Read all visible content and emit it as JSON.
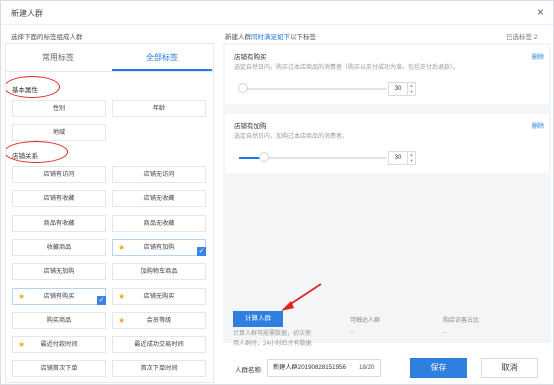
{
  "dialog": {
    "title": "新建人群",
    "close_icon": "close-icon"
  },
  "left_hint": "选择下面的标签组成人群",
  "right_hint": {
    "prefix": "新建人群",
    "accent": "同时满足如下",
    "suffix": "以下标签"
  },
  "selected_count": "已选标签 2",
  "tabs": [
    {
      "label": "常用标签"
    },
    {
      "label": "全部标签",
      "active": true
    }
  ],
  "sections": {
    "basic": "基本属性",
    "shop": "店铺关系"
  },
  "basic_tags": [
    {
      "label": "性别"
    },
    {
      "label": "年龄"
    },
    {
      "label": "地域"
    }
  ],
  "shop_tags": [
    {
      "label": "店铺有访问",
      "star": false,
      "selected": false
    },
    {
      "label": "店铺无访问",
      "star": false,
      "selected": false
    },
    {
      "label": "店铺有收藏",
      "star": false,
      "selected": false
    },
    {
      "label": "店铺无收藏",
      "star": false,
      "selected": false
    },
    {
      "label": "商品有收藏",
      "star": false,
      "selected": false
    },
    {
      "label": "商品无收藏",
      "star": false,
      "selected": false
    },
    {
      "label": "收藏商品",
      "star": false,
      "selected": false
    },
    {
      "label": "店铺有加购",
      "star": true,
      "selected": true
    },
    {
      "label": "店铺无加购",
      "star": false,
      "selected": false
    },
    {
      "label": "加购物车商品",
      "star": false,
      "selected": false
    },
    {
      "label": "店铺有购买",
      "star": true,
      "selected": true
    },
    {
      "label": "店铺无购买",
      "star": true,
      "selected": false
    },
    {
      "label": "购买商品",
      "star": false,
      "selected": false
    },
    {
      "label": "会员等级",
      "star": true,
      "selected": false
    },
    {
      "label": "最近付款时间",
      "star": true,
      "selected": false
    },
    {
      "label": "最近成功交易时间",
      "star": false,
      "selected": false
    },
    {
      "label": "店铺首次下单",
      "star": false,
      "selected": false
    },
    {
      "label": "首次下单时间",
      "star": false,
      "selected": false
    }
  ],
  "cards": [
    {
      "title": "店铺有购买",
      "desc": "选定自然日内，购买过本店商品的消费者（购买以支付成功为准，包括支付后退款）。",
      "delete_label": "删除",
      "value": "30",
      "slider_fraction": 0.03
    },
    {
      "title": "店铺有加购",
      "desc": "选定自然日内，加购过本店商品的消费者。",
      "delete_label": "删除",
      "value": "30",
      "slider_fraction": 0.17
    }
  ],
  "calc": {
    "button_label": "计算人群",
    "hint_line1": "计算人群可能需数据，初次使",
    "hint_line2": "用人群时，24小时后才有数据"
  },
  "metrics": [
    {
      "label": "可触达人群",
      "value": "--"
    },
    {
      "label": "购店访客占比",
      "value": "--"
    }
  ],
  "footer": {
    "name_label": "人群名称",
    "name_value": "新建人群20190828151956",
    "name_count": "18/20",
    "save_label": "保存",
    "cancel_label": "取消"
  },
  "annotation_color": "#e02424",
  "accent_color": "#2f7fe0"
}
